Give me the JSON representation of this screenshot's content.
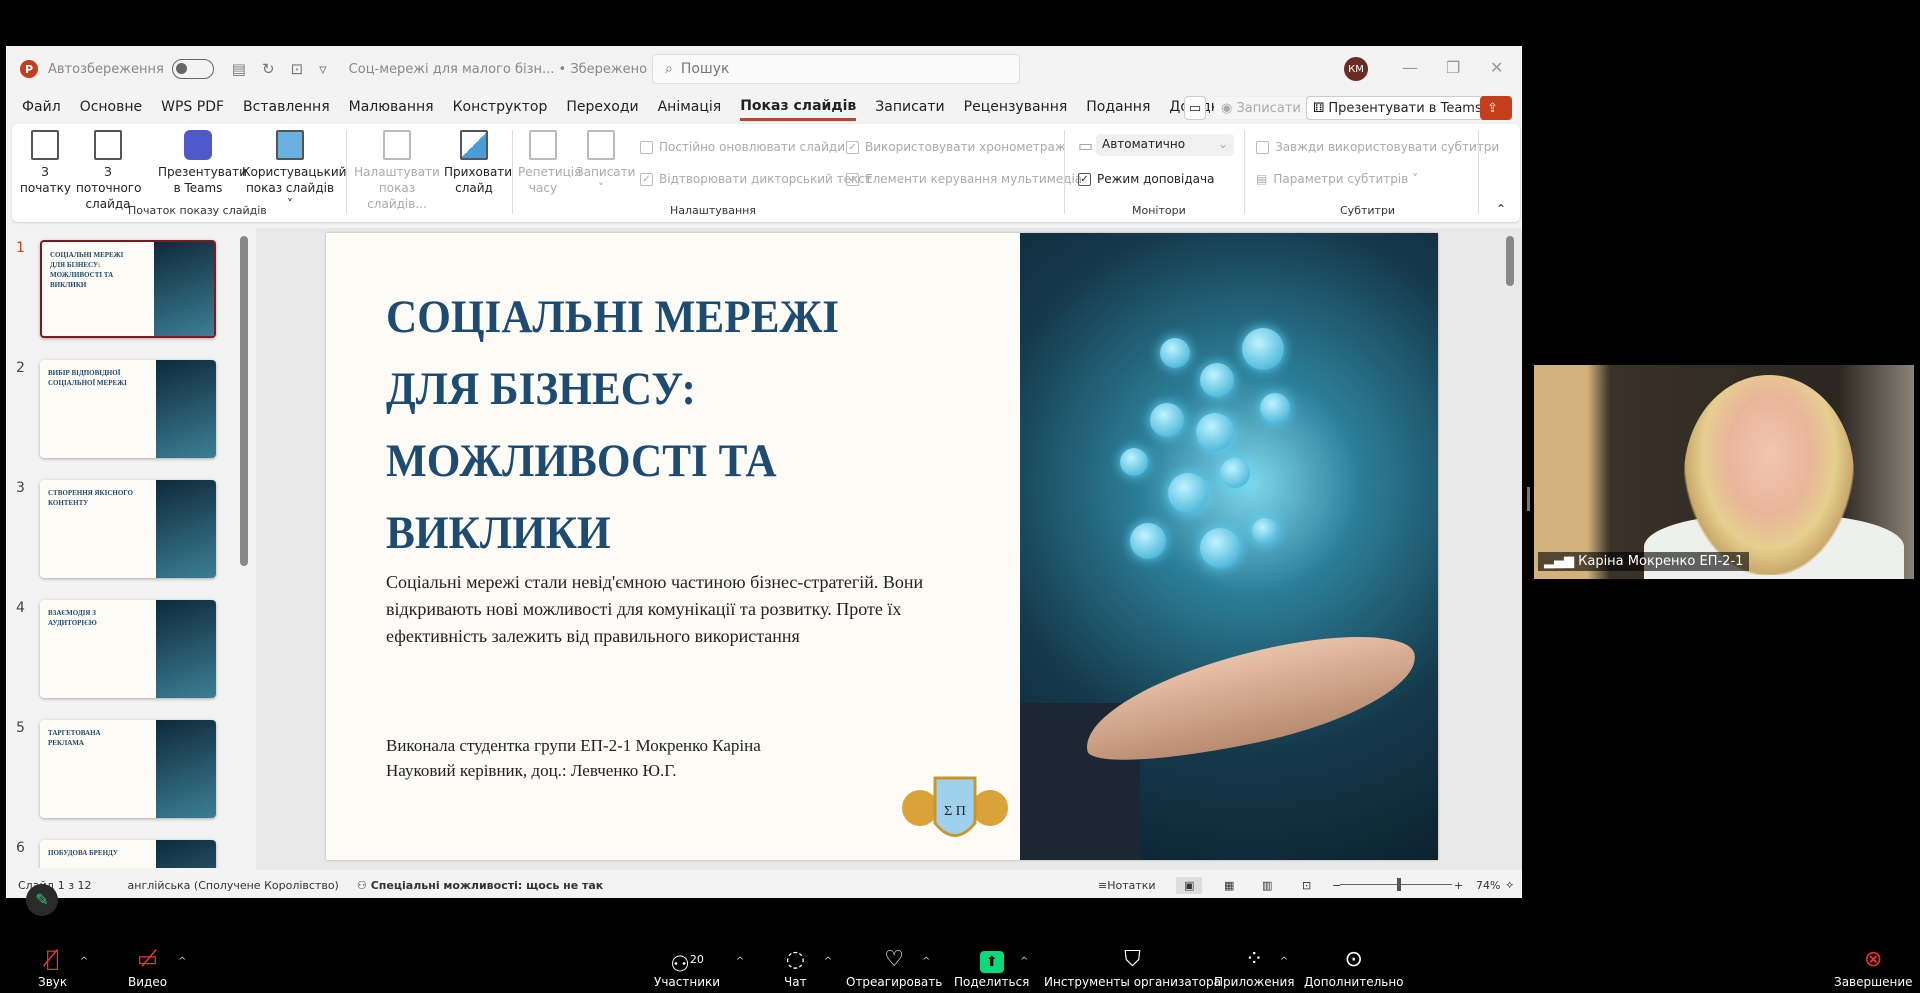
{
  "titlebar": {
    "autosave": "Автозбереження",
    "doc": "Соц-мережі для малого бізн... • Збережено у цей ПК ⌄",
    "search_placeholder": "Пошук",
    "avatar": "КМ"
  },
  "tabs": [
    "Файл",
    "Основне",
    "WPS PDF",
    "Вставлення",
    "Малювання",
    "Конструктор",
    "Переходи",
    "Анімація",
    "Показ слайдів",
    "Записати",
    "Рецензування",
    "Подання",
    "Довідка"
  ],
  "active_tab": "Показ слайдів",
  "tab_actions": {
    "record": "◉ Записати",
    "present_teams": "Презентувати в Teams"
  },
  "ribbon": {
    "from_start": "З початку",
    "from_current": "З поточного слайда",
    "present_teams": "Презентувати в Teams",
    "custom": "Користувацький показ слайдів ˅",
    "group_start": "Початок показу слайдів",
    "setup": "Налаштувати показ слайдів...",
    "hide": "Приховати слайд",
    "rehearse": "Репетиція часу",
    "record": "Записати ˅",
    "keep_updated": "Постійно оновлювати слайди",
    "play_narr": "Відтворювати дикторський текст",
    "use_timings": "Використовувати хронометраж",
    "media_controls": "Елементи керування мультимедіа",
    "group_setup": "Налаштування",
    "monitor": "Автоматично",
    "presenter_view": "Режим доповідача",
    "group_monitors": "Монітори",
    "always_subs": "Завжди використовувати субтитри",
    "sub_settings": "Параметри субтитрів ˅",
    "group_subs": "Субтитри"
  },
  "thumbnails": [
    {
      "n": "1",
      "title": "СОЦІАЛЬНІ МЕРЕЖІ ДЛЯ БІЗНЕСУ: МОЖЛИВОСТІ ТА ВИКЛИКИ"
    },
    {
      "n": "2",
      "title": "ВИБІР ВІДПОВІДНОЇ СОЦІАЛЬНОЇ МЕРЕЖІ"
    },
    {
      "n": "3",
      "title": "СТВОРЕННЯ ЯКІСНОГО КОНТЕНТУ"
    },
    {
      "n": "4",
      "title": "ВЗАЄМОДІЯ З АУДИТОРІЄЮ"
    },
    {
      "n": "5",
      "title": "ТАРГЕТОВАНА РЕКЛАМА"
    },
    {
      "n": "6",
      "title": "ПОБУДОВА БРЕНДУ"
    }
  ],
  "slide": {
    "title": "СОЦІАЛЬНІ МЕРЕЖІ ДЛЯ БІЗНЕСУ: МОЖЛИВОСТІ ТА ВИКЛИКИ",
    "body": "Соціальні мережі стали невід'ємною частиною бізнес-стратегій. Вони відкривають нові можливості для комунікації та розвитку. Проте їх ефективність залежить від правильного використання",
    "author": "Виконала студентка групи ЕП-2-1 Мокренко Каріна",
    "supervisor": "Науковий керівник, доц.: Левченко Ю.Г.",
    "crest_text": "Σ П"
  },
  "status": {
    "slide": "Слайд 1 з 12",
    "lang": "англійська (Сполучене Королівство)",
    "access": "Спеціальні можливості: щось не так",
    "notes": "Нотатки",
    "zoom": "74%",
    "zoom_level": 74
  },
  "video": {
    "name": "Каріна Мокренко ЕП-2-1"
  },
  "meeting": {
    "audio": "Звук",
    "video": "Видео",
    "participants": "Участники",
    "participants_count": "20",
    "chat": "Чат",
    "react": "Отреагировать",
    "share": "Поделиться",
    "host": "Инструменты организатора",
    "apps": "Приложения",
    "more": "Дополнительно",
    "end": "Завершение",
    "share_color": "#0bd87a"
  }
}
